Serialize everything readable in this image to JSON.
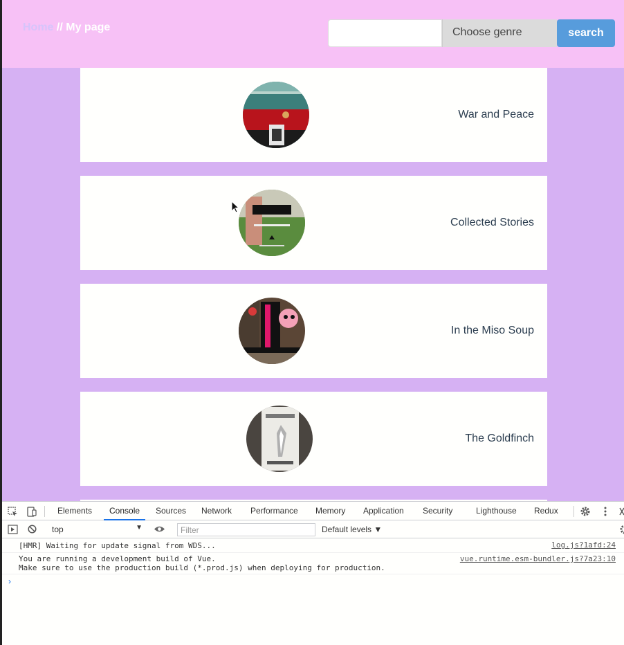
{
  "header": {
    "breadcrumb_home": "Home",
    "breadcrumb_sep": "//",
    "breadcrumb_current": "My page",
    "search_value": "",
    "genre_select": "Choose genre",
    "search_button": "search"
  },
  "books": [
    {
      "title": "War and Peace"
    },
    {
      "title": "Collected Stories"
    },
    {
      "title": "In the Miso Soup"
    },
    {
      "title": "The Goldfinch"
    }
  ],
  "devtools": {
    "tabs": [
      "Elements",
      "Console",
      "Sources",
      "Network",
      "Performance",
      "Memory",
      "Application",
      "Security",
      "Lighthouse",
      "Redux"
    ],
    "active_tab": "Console",
    "context": "top",
    "filter_placeholder": "Filter",
    "levels": "Default levels ▼",
    "logs": [
      {
        "message": "[HMR] Waiting for update signal from WDS...",
        "source": "log.js?1afd:24"
      },
      {
        "message": "You are running a development build of Vue.\nMake sure to use the production build (*.prod.js) when deploying for production.",
        "source": "vue.runtime.esm-bundler.js?7a23:10"
      }
    ],
    "prompt": "›"
  },
  "colors": {
    "header_bg": "#f7c1f6",
    "content_bg": "#d6b1f3",
    "search_button_bg": "#579cdc",
    "active_tab_underline": "#1a73e8"
  }
}
